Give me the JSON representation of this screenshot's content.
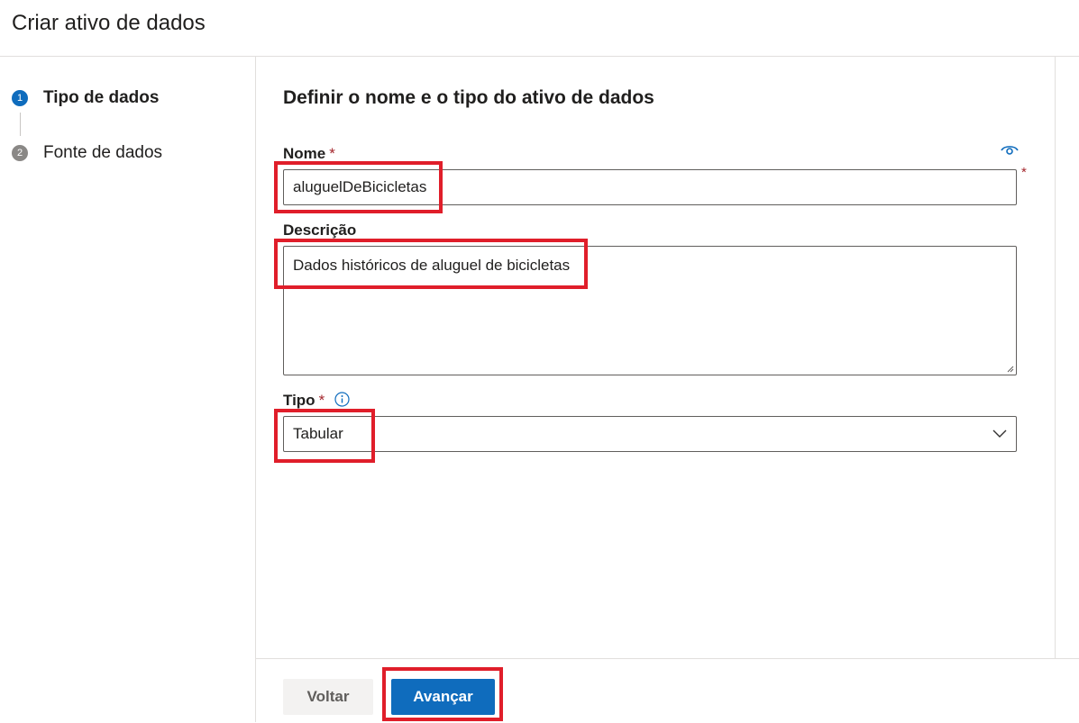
{
  "header": {
    "title": "Criar ativo de dados"
  },
  "steps": [
    {
      "number": "1",
      "label": "Tipo de dados",
      "state": "active"
    },
    {
      "number": "2",
      "label": "Fonte de dados",
      "state": "inactive"
    }
  ],
  "form": {
    "section_title": "Definir o nome e o tipo do ativo de dados",
    "name": {
      "label": "Nome",
      "required_mark": "*",
      "value": "aluguelDeBicicletas"
    },
    "description": {
      "label": "Descrição",
      "value": "Dados históricos de aluguel de bicicletas"
    },
    "type": {
      "label": "Tipo",
      "required_mark": "*",
      "value": "Tabular"
    }
  },
  "footer": {
    "back_label": "Voltar",
    "next_label": "Avançar"
  },
  "colors": {
    "accent": "#0f6cbd",
    "required": "#a4262c",
    "highlight": "#e01e2a"
  },
  "icons": [
    "eye-icon",
    "info-icon",
    "chevron-down-icon",
    "resize-grip-icon"
  ]
}
